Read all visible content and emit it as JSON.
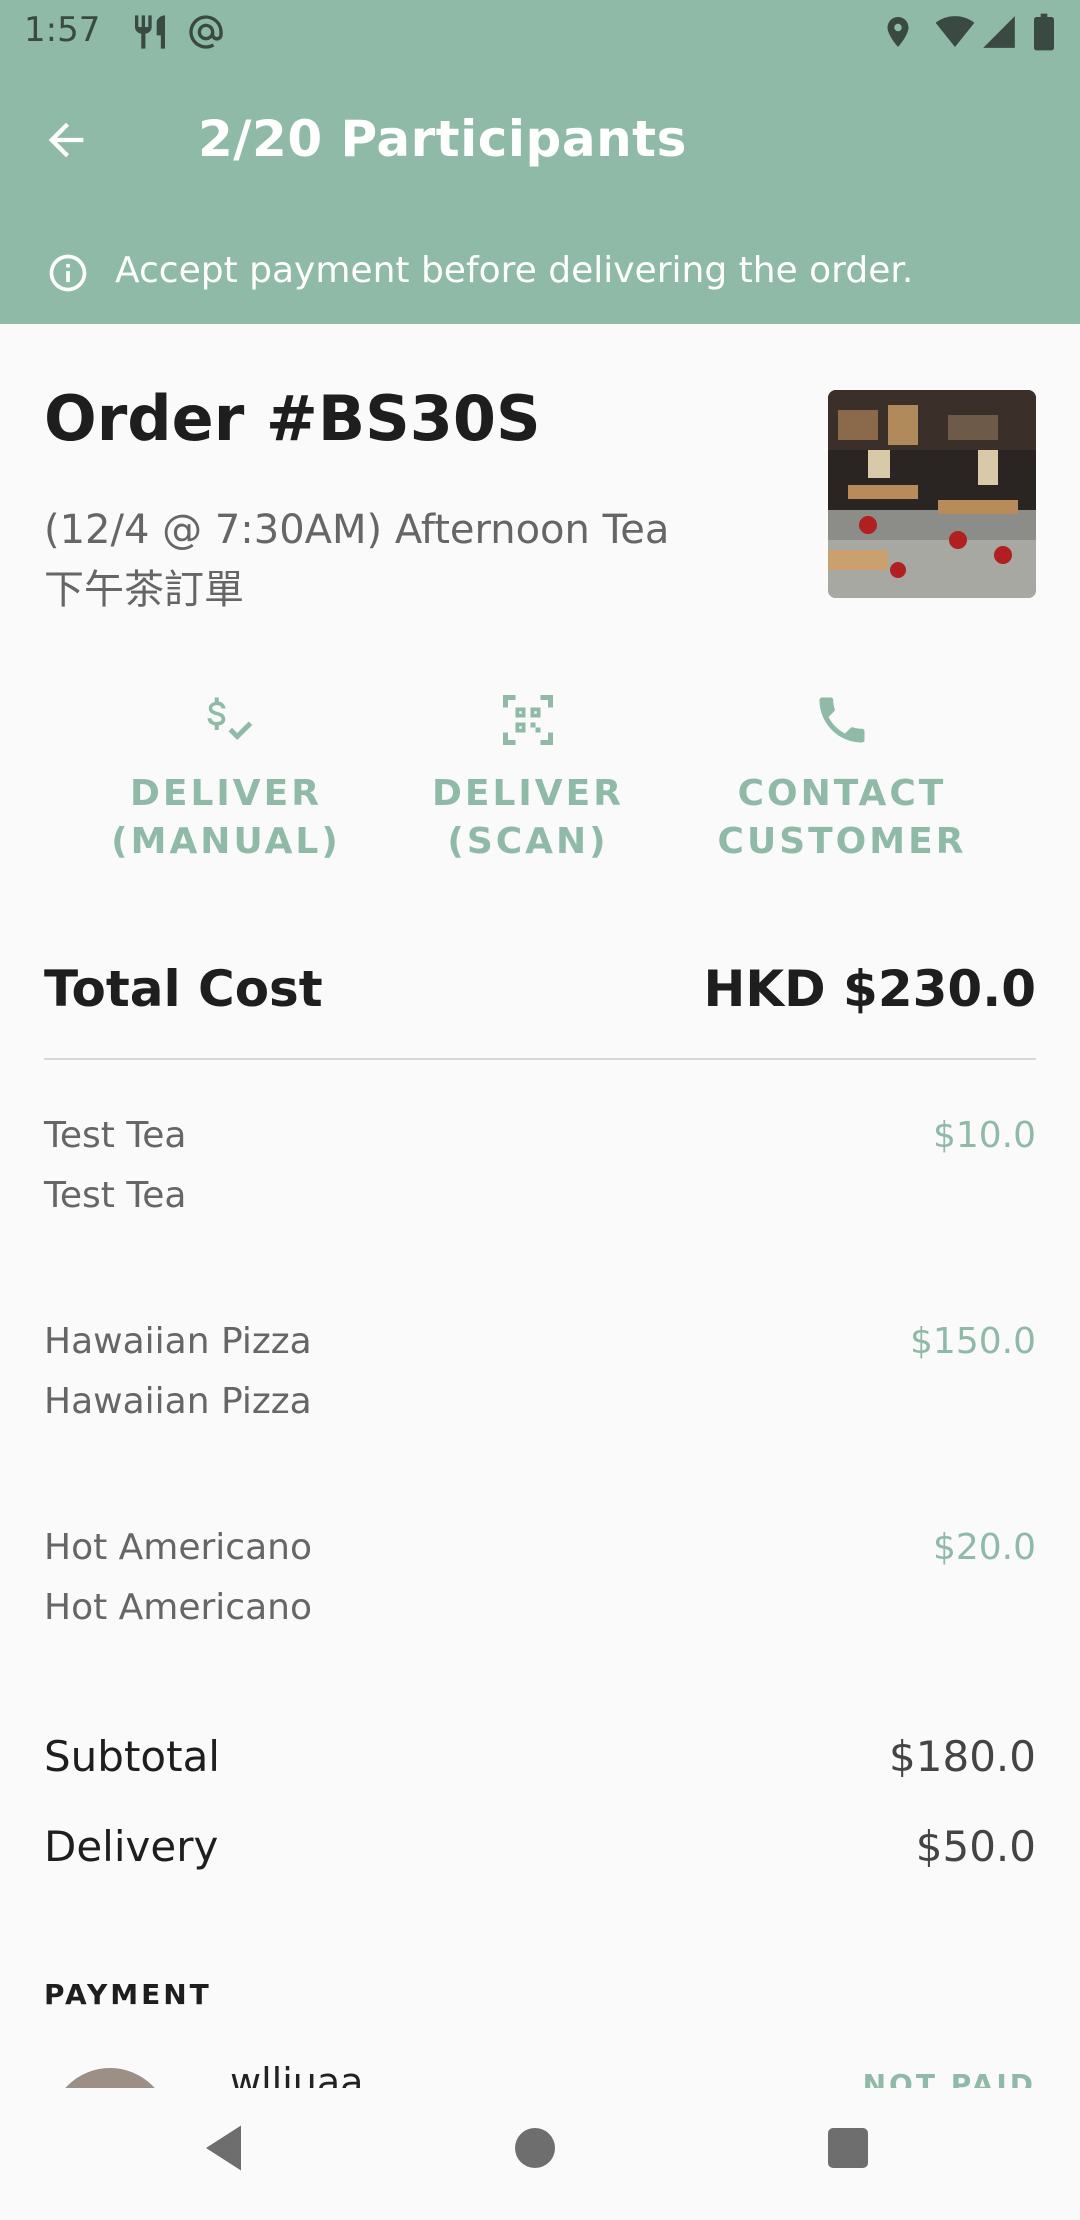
{
  "status_bar": {
    "time": "1:57",
    "left_icons": [
      "restaurant-icon",
      "at-sign-icon"
    ],
    "right_icons": [
      "location-icon",
      "wifi-icon",
      "signal-icon",
      "battery-icon"
    ]
  },
  "app_bar": {
    "title": "2/20 Participants",
    "back_icon": "back-arrow-icon"
  },
  "banner": {
    "icon": "info-icon",
    "text": "Accept payment before delivering the order."
  },
  "order": {
    "title": "Order #BS30S",
    "subtitle_line1": "(12/4 @ 7:30AM) Afternoon Tea",
    "subtitle_line2": "下午茶訂單"
  },
  "actions": [
    {
      "icon": "dollar-check-icon",
      "line1": "DELIVER",
      "line2": "(MANUAL)"
    },
    {
      "icon": "qr-scan-icon",
      "line1": "DELIVER",
      "line2": "(SCAN)"
    },
    {
      "icon": "phone-icon",
      "line1": "CONTACT",
      "line2": "CUSTOMER"
    }
  ],
  "total": {
    "label": "Total Cost",
    "value": "HKD $230.0"
  },
  "items": [
    {
      "name": "Test Tea",
      "detail": "Test Tea",
      "price": "$10.0"
    },
    {
      "name": "Hawaiian Pizza",
      "detail": "Hawaiian Pizza",
      "price": "$150.0"
    },
    {
      "name": "Hot Americano",
      "detail": "Hot Americano",
      "price": "$20.0"
    }
  ],
  "summary": {
    "subtotal_label": "Subtotal",
    "subtotal_value": "$180.0",
    "delivery_label": "Delivery",
    "delivery_value": "$50.0"
  },
  "payment": {
    "section_label": "PAYMENT",
    "payer_name": "wlliuaa",
    "status": "NOT PAID"
  },
  "colors": {
    "accent": "#8fbaa8",
    "text_primary": "#1e1e1e",
    "text_secondary": "#666666"
  }
}
